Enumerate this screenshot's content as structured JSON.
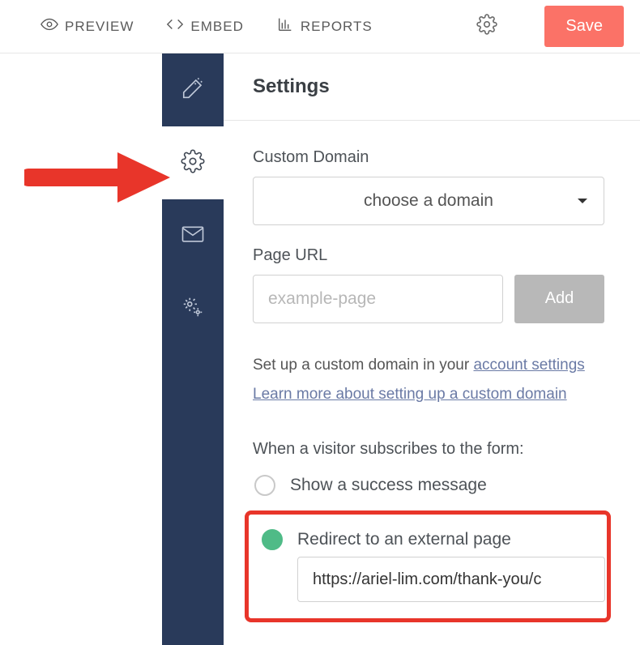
{
  "topbar": {
    "preview": "PREVIEW",
    "embed": "EMBED",
    "reports": "REPORTS",
    "save": "Save"
  },
  "sidebar": {
    "items": [
      {
        "name": "wand-icon"
      },
      {
        "name": "settings-gear-icon"
      },
      {
        "name": "mail-icon"
      },
      {
        "name": "gears-icon"
      }
    ],
    "active_index": 1
  },
  "page_title": "Settings",
  "custom_domain": {
    "label": "Custom Domain",
    "placeholder": "choose a domain"
  },
  "page_url": {
    "label": "Page URL",
    "placeholder": "example-page",
    "add_btn": "Add"
  },
  "help": {
    "prefix": "Set up a custom domain in your ",
    "link1": "account settings",
    "link2": "Learn more about setting up a custom domain"
  },
  "subscribe": {
    "heading": "When a visitor subscribes to the form:",
    "option_success": "Show a success message",
    "option_redirect": "Redirect to an external page",
    "redirect_url": "https://ariel-lim.com/thank-you/c"
  }
}
